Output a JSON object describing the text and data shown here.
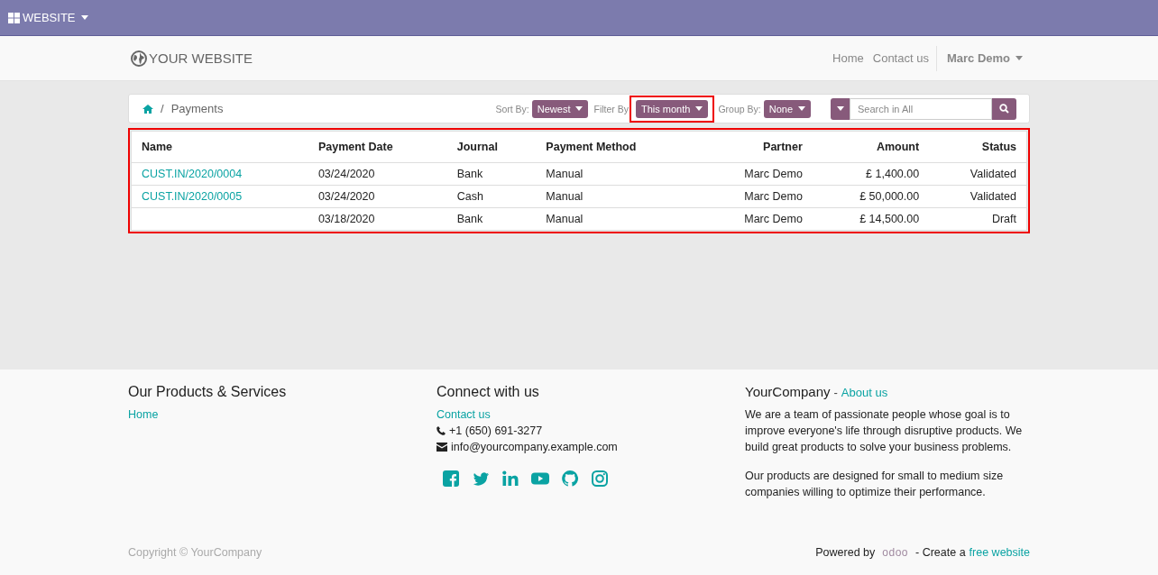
{
  "topbar": {
    "app_menu": "WEBSITE"
  },
  "header": {
    "logo": "YOUR WEBSITE",
    "nav": [
      {
        "label": "Home"
      },
      {
        "label": "Contact us"
      }
    ],
    "user": "Marc Demo"
  },
  "breadcrumb": {
    "separator": "/",
    "current": "Payments"
  },
  "controls": [
    {
      "label": "Sort By:",
      "value": "Newest",
      "highlighted": false
    },
    {
      "label": "Filter By",
      "value": "This month",
      "highlighted": true
    },
    {
      "label": "Group By:",
      "value": "None",
      "highlighted": false
    }
  ],
  "search": {
    "placeholder": "Search in All"
  },
  "table": {
    "highlighted": true,
    "columns": [
      "Name",
      "Payment Date",
      "Journal",
      "Payment Method",
      "Partner",
      "Amount",
      "Status"
    ],
    "rows": [
      [
        "CUST.IN/2020/0004",
        "03/24/2020",
        "Bank",
        "Manual",
        "Marc Demo",
        "£ 1,400.00",
        "Validated"
      ],
      [
        "CUST.IN/2020/0005",
        "03/24/2020",
        "Cash",
        "Manual",
        "Marc Demo",
        "£ 50,000.00",
        "Validated"
      ],
      [
        "",
        "03/18/2020",
        "Bank",
        "Manual",
        "Marc Demo",
        "£ 14,500.00",
        "Draft"
      ]
    ]
  },
  "footer": {
    "products": {
      "title": "Our Products & Services",
      "links": [
        "Home"
      ]
    },
    "connect": {
      "title": "Connect with us",
      "link": "Contact us",
      "phone": "+1 (650) 691-3277",
      "email": "info@yourcompany.example.com"
    },
    "about": {
      "title": "YourCompany",
      "separator": "-",
      "link": "About us",
      "paragraphs": [
        "We are a team of passionate people whose goal is to improve everyone's life through disruptive products. We build great products to solve your business problems.",
        "Our products are designed for small to medium size companies willing to optimize their performance."
      ]
    },
    "copyright": "Copyright © YourCompany",
    "powered": {
      "prefix": "Powered by",
      "logo": "odoo",
      "middle": "- Create a",
      "link": "free website"
    }
  }
}
